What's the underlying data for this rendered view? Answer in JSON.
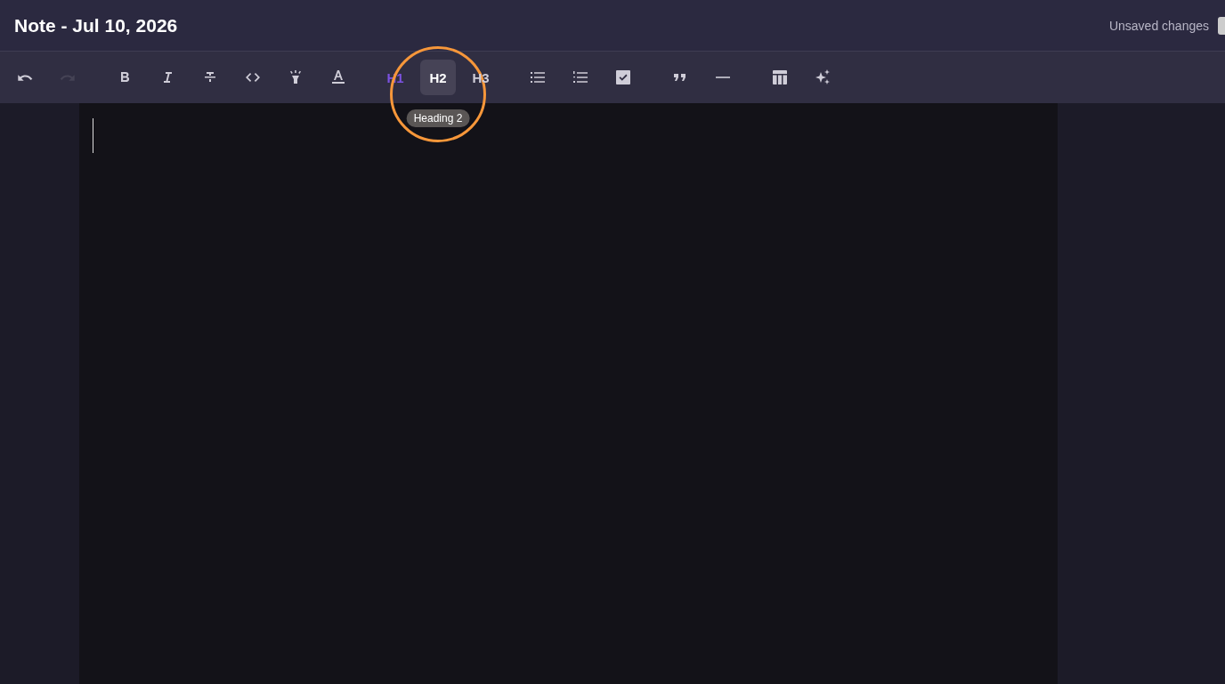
{
  "header": {
    "title": "Note - Jul 10, 2026",
    "status": "Unsaved changes"
  },
  "toolbar": {
    "groups": [
      [
        {
          "kind": "undo",
          "disabled": false
        },
        {
          "kind": "redo",
          "disabled": true
        }
      ],
      [
        {
          "kind": "bold",
          "disabled": false
        },
        {
          "kind": "italic",
          "disabled": false
        },
        {
          "kind": "strike",
          "disabled": false
        },
        {
          "kind": "code",
          "disabled": false
        },
        {
          "kind": "highlight",
          "disabled": false
        },
        {
          "kind": "color",
          "disabled": false
        }
      ],
      [
        {
          "kind": "heading",
          "label": "H1",
          "selected": true,
          "hovered": false
        },
        {
          "kind": "heading",
          "label": "H2",
          "selected": false,
          "hovered": true,
          "tooltip": "Heading 2"
        },
        {
          "kind": "heading",
          "label": "H3",
          "selected": false,
          "hovered": false
        }
      ],
      [
        {
          "kind": "bullets",
          "disabled": false
        },
        {
          "kind": "numbers",
          "disabled": false
        },
        {
          "kind": "checklist",
          "disabled": false
        }
      ],
      [
        {
          "kind": "quote",
          "disabled": false
        },
        {
          "kind": "rule",
          "disabled": false
        }
      ],
      [
        {
          "kind": "table",
          "disabled": false
        },
        {
          "kind": "sparkle",
          "disabled": false
        }
      ]
    ]
  },
  "editor": {
    "focused": true
  }
}
